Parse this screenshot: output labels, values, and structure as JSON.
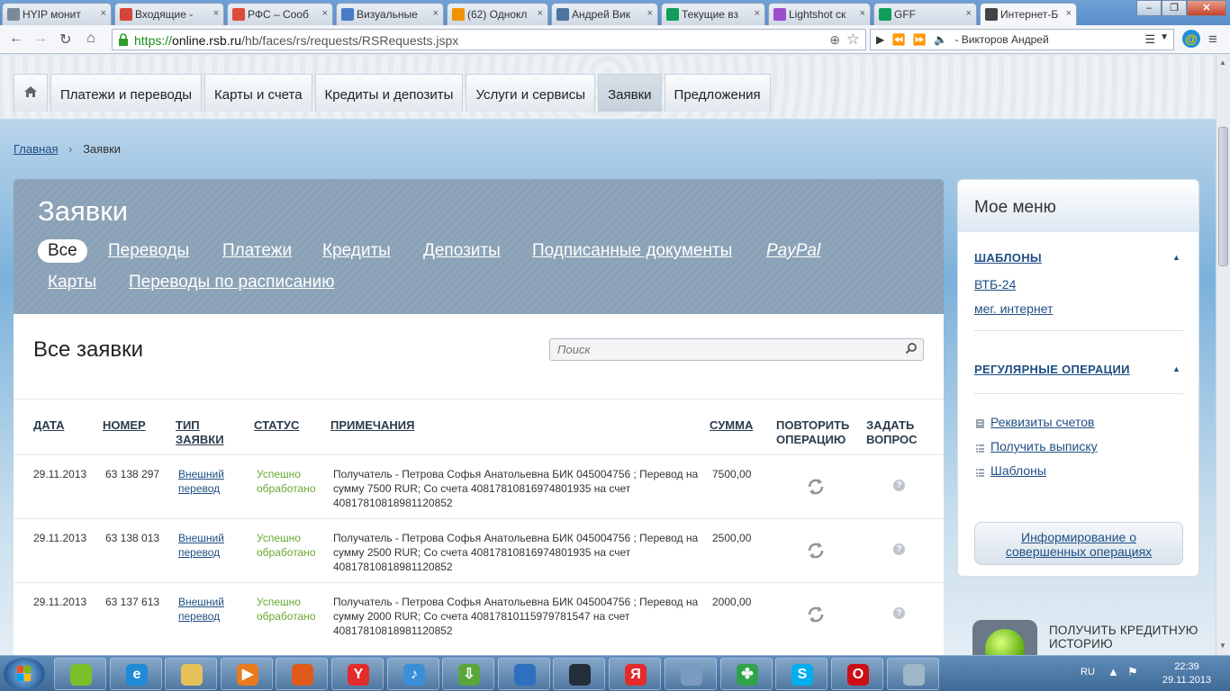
{
  "browser": {
    "tabs": [
      {
        "title": "HYIP монит",
        "color": "#7a8a9a"
      },
      {
        "title": "Входящие -",
        "color": "#d44638"
      },
      {
        "title": "РФС – Сооб",
        "color": "#dd4b39"
      },
      {
        "title": "Визуальные",
        "color": "#4a7bc8"
      },
      {
        "title": "(62) Однокл",
        "color": "#f39200"
      },
      {
        "title": "Андрей Вик",
        "color": "#4c75a3"
      },
      {
        "title": "Текущие вз",
        "color": "#0f9d58"
      },
      {
        "title": "Lightshot ск",
        "color": "#9c4dcc"
      },
      {
        "title": "GFF",
        "color": "#0f9d58"
      },
      {
        "title": "Интернет-Б",
        "color": "#444444"
      }
    ],
    "url_prefix": "https://",
    "url_domain": "online.rsb.ru",
    "url_path": "/hb/faces/rs/requests/RSRequests.jspx",
    "player_text": "- Викторов Андрей"
  },
  "nav": {
    "items": [
      "Платежи и переводы",
      "Карты и счета",
      "Кредиты и депозиты",
      "Услуги и сервисы",
      "Заявки",
      "Предложения"
    ],
    "active_index": 4
  },
  "breadcrumb": {
    "home": "Главная",
    "current": "Заявки"
  },
  "panel": {
    "title": "Заявки",
    "filters": [
      "Все",
      "Переводы",
      "Платежи",
      "Кредиты",
      "Депозиты",
      "Подписанные документы",
      "PayPal",
      "Карты",
      "Переводы по расписанию"
    ],
    "subtitle": "Все заявки",
    "search_placeholder": "Поиск"
  },
  "table": {
    "headers": {
      "date": "ДАТА",
      "number": "НОМЕР",
      "type_1": "ТИП",
      "type_2": "ЗАЯВКИ",
      "status": "СТАТУС",
      "notes": "ПРИМЕЧАНИЯ",
      "amount": "СУММА",
      "repeat_1": "ПОВТОРИТЬ",
      "repeat_2": "ОПЕРАЦИЮ",
      "ask_1": "ЗАДАТЬ",
      "ask_2": "ВОПРОС"
    },
    "rows": [
      {
        "date": "29.11.2013",
        "number": "63 138 297",
        "type_1": "Внешний",
        "type_2": "перевод",
        "status_1": "Успешно",
        "status_2": "обработано",
        "notes": "Получатель - Петрова Софья Анатольевна БИК 045004756 ; Перевод на сумму 7500 RUR; Со счета 40817810816974801935 на счет 40817810818981120852",
        "amount": "7500,00"
      },
      {
        "date": "29.11.2013",
        "number": "63 138 013",
        "type_1": "Внешний",
        "type_2": "перевод",
        "status_1": "Успешно",
        "status_2": "обработано",
        "notes": "Получатель - Петрова Софья Анатольевна БИК 045004756 ; Перевод на сумму 2500 RUR; Со счета 40817810816974801935 на счет 40817810818981120852",
        "amount": "2500,00"
      },
      {
        "date": "29.11.2013",
        "number": "63 137 613",
        "type_1": "Внешний",
        "type_2": "перевод",
        "status_1": "Успешно",
        "status_2": "обработано",
        "notes": "Получатель - Петрова Софья Анатольевна БИК 045004756 ; Перевод на сумму 2000 RUR; Со счета 40817810115979781547 на счет 40817810818981120852",
        "amount": "2000,00"
      }
    ]
  },
  "sidemenu": {
    "title": "Мое меню",
    "templates_title": "ШАБЛОНЫ",
    "templates": [
      "ВТБ-24",
      "мег. интернет"
    ],
    "regular_title": "РЕГУЛЯРНЫЕ ОПЕРАЦИИ",
    "regular_items": [
      "Реквизиты счетов",
      "Получить выписку",
      "Шаблоны"
    ],
    "info_button_1": "Информирование о",
    "info_button_2": "совершенных операциях"
  },
  "promo": {
    "line_1": "ПОЛУЧИТЬ КРЕДИТНУЮ",
    "line_2": "ИСТОРИЮ"
  },
  "taskbar": {
    "apps": [
      {
        "name": "green-app-icon",
        "glyph": "",
        "color": "#7bbf2a"
      },
      {
        "name": "internet-explorer-icon",
        "glyph": "e",
        "color": "#1f8ad6"
      },
      {
        "name": "file-explorer-icon",
        "glyph": "",
        "color": "#e6c15a"
      },
      {
        "name": "media-player-icon",
        "glyph": "▶",
        "color": "#e87a1d"
      },
      {
        "name": "paint-app-icon",
        "glyph": "",
        "color": "#e05a1a"
      },
      {
        "name": "yandex-browser-icon",
        "glyph": "Y",
        "color": "#e32b2b"
      },
      {
        "name": "music-app-icon",
        "glyph": "♪",
        "color": "#3a8fd8"
      },
      {
        "name": "download-app-icon",
        "glyph": "⇩",
        "color": "#5aa63a"
      },
      {
        "name": "video-converter-icon",
        "glyph": "",
        "color": "#2f6fc0"
      },
      {
        "name": "kmplayer-icon",
        "glyph": "",
        "color": "#222f3a"
      },
      {
        "name": "yandex-icon",
        "glyph": "Я",
        "color": "#e32b2b"
      },
      {
        "name": "volume-app-icon",
        "glyph": "",
        "color": "#7a9ac0"
      },
      {
        "name": "clover-app-icon",
        "glyph": "✤",
        "color": "#2ea34a"
      },
      {
        "name": "skype-icon",
        "glyph": "S",
        "color": "#00aff0"
      },
      {
        "name": "opera-icon",
        "glyph": "O",
        "color": "#cc0f16"
      },
      {
        "name": "notepad-icon",
        "glyph": "",
        "color": "#9fb6c8"
      }
    ],
    "lang": "RU",
    "time": "22:39",
    "date": "29.11.2013"
  }
}
